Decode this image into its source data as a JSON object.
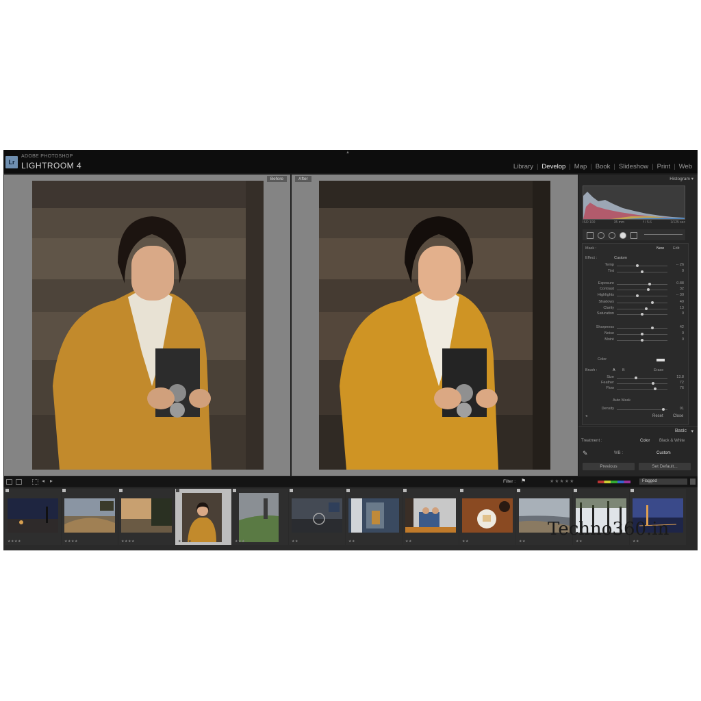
{
  "app": {
    "badge": "Lr",
    "subtitle": "ADOBE PHOTOSHOP",
    "title": "LIGHTROOM 4",
    "modules": [
      "Library",
      "Develop",
      "Map",
      "Book",
      "Slideshow",
      "Print",
      "Web"
    ],
    "active_module": "Develop"
  },
  "compare": {
    "before_label": "Before",
    "after_label": "After"
  },
  "right_panel": {
    "histogram_title": "Histogram",
    "histogram_labels": [
      "ISO 100",
      "35 mm",
      "f / 5.6",
      "1/125 sec"
    ],
    "mask": {
      "label": "Mask :",
      "new": "New",
      "edit": "Edit"
    },
    "effect": {
      "label": "Effect :",
      "value": "Custom"
    },
    "sliders": [
      {
        "label": "Temp",
        "pos": 0.4,
        "value": "-- 26"
      },
      {
        "label": "Tint",
        "pos": 0.5,
        "value": "0"
      },
      {
        "label": "Exposure",
        "pos": 0.65,
        "value": "0.88"
      },
      {
        "label": "Contrast",
        "pos": 0.62,
        "value": "32"
      },
      {
        "label": "Highlights",
        "pos": 0.4,
        "value": "-- 30"
      },
      {
        "label": "Shadows",
        "pos": 0.7,
        "value": "40"
      },
      {
        "label": "Clarity",
        "pos": 0.58,
        "value": "13"
      },
      {
        "label": "Saturation",
        "pos": 0.5,
        "value": "0"
      },
      {
        "label": "Sharpness",
        "pos": 0.7,
        "value": "42"
      },
      {
        "label": "Noise",
        "pos": 0.5,
        "value": "0"
      },
      {
        "label": "Moiré",
        "pos": 0.5,
        "value": "0"
      }
    ],
    "color_label": "Color",
    "brush": {
      "label": "Brush :",
      "a": "A",
      "b": "B",
      "erase": "Erase"
    },
    "brush_sliders": [
      {
        "label": "Size",
        "pos": 0.38,
        "value": "13.8"
      },
      {
        "label": "Feather",
        "pos": 0.72,
        "value": "72"
      },
      {
        "label": "Flow",
        "pos": 0.75,
        "value": "76"
      },
      {
        "label": "Density",
        "pos": 0.92,
        "value": "91"
      }
    ],
    "auto_mask": "Auto Mask",
    "reset": "Reset",
    "close": "Close",
    "basic_title": "Basic",
    "treatment": {
      "label": "Treatment :",
      "color": "Color",
      "bw": "Black & White"
    },
    "wb": {
      "label": "WB :",
      "value": "Custom"
    },
    "previous": "Previous",
    "set_default": "Set Default..."
  },
  "filmstrip": {
    "filter_label": "Filter :",
    "filter_value": "Flagged",
    "stars_glyph": "★★★★★",
    "thumb_stars": [
      "★★★★",
      "★★★★",
      "★★★★",
      "★★★★",
      "★★★",
      "★★",
      "★★",
      "★★",
      "★★",
      "★★",
      "★★",
      "★★"
    ]
  },
  "watermark": "Techno360.in"
}
